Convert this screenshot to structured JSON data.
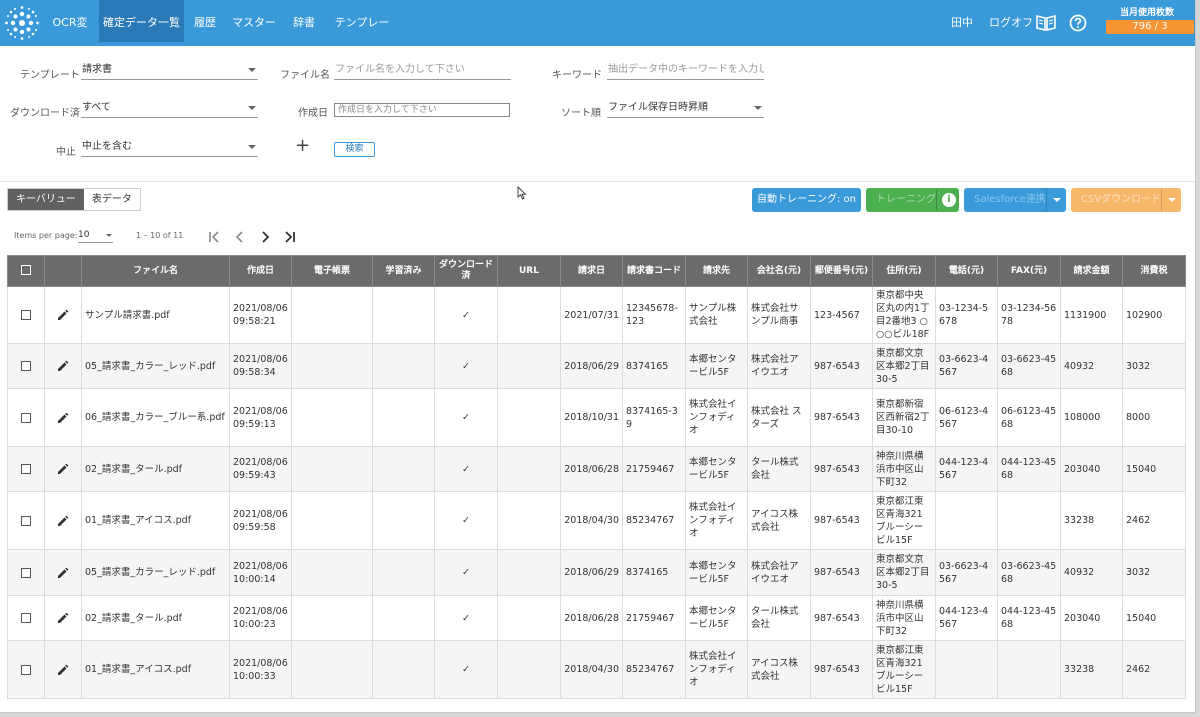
{
  "nav": {
    "tabs": [
      {
        "label": "OCR変換"
      },
      {
        "label": "確定データ一覧",
        "active": true
      },
      {
        "label": "履歴"
      },
      {
        "label": "マスター"
      },
      {
        "label": "辞書"
      },
      {
        "label": "テンプレート"
      }
    ],
    "user": "田中",
    "logout": "ログオフ",
    "manual_icon": "book-icon",
    "help_icon": "help-circle-icon",
    "usage_label": "当月使用枚数",
    "usage_value": "796 / 3"
  },
  "filters": {
    "template": {
      "label": "テンプレート",
      "value": "請求書"
    },
    "filename": {
      "label": "ファイル名",
      "placeholder": "ファイル名を入力して下さい"
    },
    "keyword": {
      "label": "キーワード",
      "placeholder": "抽出データ中のキーワードを入力し…"
    },
    "downloaded": {
      "label": "ダウンロード済",
      "value": "すべて"
    },
    "created": {
      "label": "作成日",
      "placeholder": "作成日を入力して下さい"
    },
    "sort": {
      "label": "ソート順",
      "value": "ファイル保存日時昇順"
    },
    "cancel": {
      "label": "中止",
      "value": "中止を含む"
    },
    "plus": "+",
    "search_button": "検索"
  },
  "view_toggle": {
    "keyvalue": "キーバリュー",
    "table": "表データ"
  },
  "actions": {
    "auto_training": "自動トレーニング: on",
    "training": "トレーニング",
    "salesforce": "Salesforce連携",
    "csv": "CSVダウンロード"
  },
  "paginator": {
    "items_per_page_label": "Items per page:",
    "items_per_page": "10",
    "range": "1 – 10 of 11",
    "first": "|<",
    "prev": "<",
    "next": ">",
    "last": ">|"
  },
  "colors": {
    "nav": "#3a9ad9",
    "usage": "#f79433",
    "training": "#4caf50",
    "csv": "#f7b86a"
  },
  "table": {
    "headers": [
      "ファイル名",
      "作成日",
      "電子帳票",
      "学習済み",
      "ダウンロード済",
      "URL",
      "請求日",
      "請求書コード",
      "請求先",
      "会社名(元)",
      "郵便番号(元)",
      "住所(元)",
      "電話(元)",
      "FAX(元)",
      "請求金額",
      "消費税"
    ],
    "rows": [
      [
        "サンプル請求書.pdf",
        "2021/08/06 09:58:21",
        "",
        "",
        "✓",
        "",
        "2021/07/31",
        "12345678-123",
        "サンプル株式会社",
        "株式会社サンプル商事",
        "123-4567",
        "東京都中央区丸の内1丁目2番地3 ○○○ビル18F",
        "03-1234-5678",
        "03-1234-5678",
        "1131900",
        "102900"
      ],
      [
        "05_請求書_カラー_レッド.pdf",
        "2021/08/06 09:58:34",
        "",
        "",
        "✓",
        "",
        "2018/06/29",
        "8374165",
        "本郷センタービル5F",
        "株式会社アイウエオ",
        "987-6543",
        "東京都文京区本郷2丁目30-5",
        "03-6623-4567",
        "03-6623-4568",
        "40932",
        "3032"
      ],
      [
        "06_請求書_カラー_ブルー系.pdf",
        "2021/08/06 09:59:13",
        "",
        "",
        "✓",
        "",
        "2018/10/31",
        "8374165-39",
        "株式会社インフォディオ",
        "株式会社 スターズ",
        "987-6543",
        "東京都新宿区西新宿2丁目30-10",
        "06-6123-4567",
        "06-6123-4568",
        "108000",
        "8000"
      ],
      [
        "02_請求書_タール.pdf",
        "2021/08/06 09:59:43",
        "",
        "",
        "✓",
        "",
        "2018/06/28",
        "21759467",
        "本郷センタービル5F",
        "タール株式会社",
        "987-6543",
        "神奈川県横浜市中区山下町32",
        "044-123-4567",
        "044-123-4568",
        "203040",
        "15040"
      ],
      [
        "01_請求書_アイコス.pdf",
        "2021/08/06 09:59:58",
        "",
        "",
        "✓",
        "",
        "2018/04/30",
        "85234767",
        "株式会社インフォディオ",
        "アイコス株式会社",
        "987-6543",
        "東京都江東区青海321 ブルーシービル15F",
        "",
        "",
        "33238",
        "2462"
      ],
      [
        "05_請求書_カラー_レッド.pdf",
        "2021/08/06 10:00:14",
        "",
        "",
        "✓",
        "",
        "2018/06/29",
        "8374165",
        "本郷センタービル5F",
        "株式会社アイウエオ",
        "987-6543",
        "東京都文京区本郷2丁目30-5",
        "03-6623-4567",
        "03-6623-4568",
        "40932",
        "3032"
      ],
      [
        "02_請求書_タール.pdf",
        "2021/08/06 10:00:23",
        "",
        "",
        "✓",
        "",
        "2018/06/28",
        "21759467",
        "本郷センタービル5F",
        "タール株式会社",
        "987-6543",
        "神奈川県横浜市中区山下町32",
        "044-123-4567",
        "044-123-4568",
        "203040",
        "15040"
      ],
      [
        "01_請求書_アイコス.pdf",
        "2021/08/06 10:00:33",
        "",
        "",
        "✓",
        "",
        "2018/04/30",
        "85234767",
        "株式会社インフォディオ",
        "アイコス株式会社",
        "987-6543",
        "東京都江東区青海321 ブルーシービル15F",
        "",
        "",
        "33238",
        "2462"
      ]
    ]
  }
}
